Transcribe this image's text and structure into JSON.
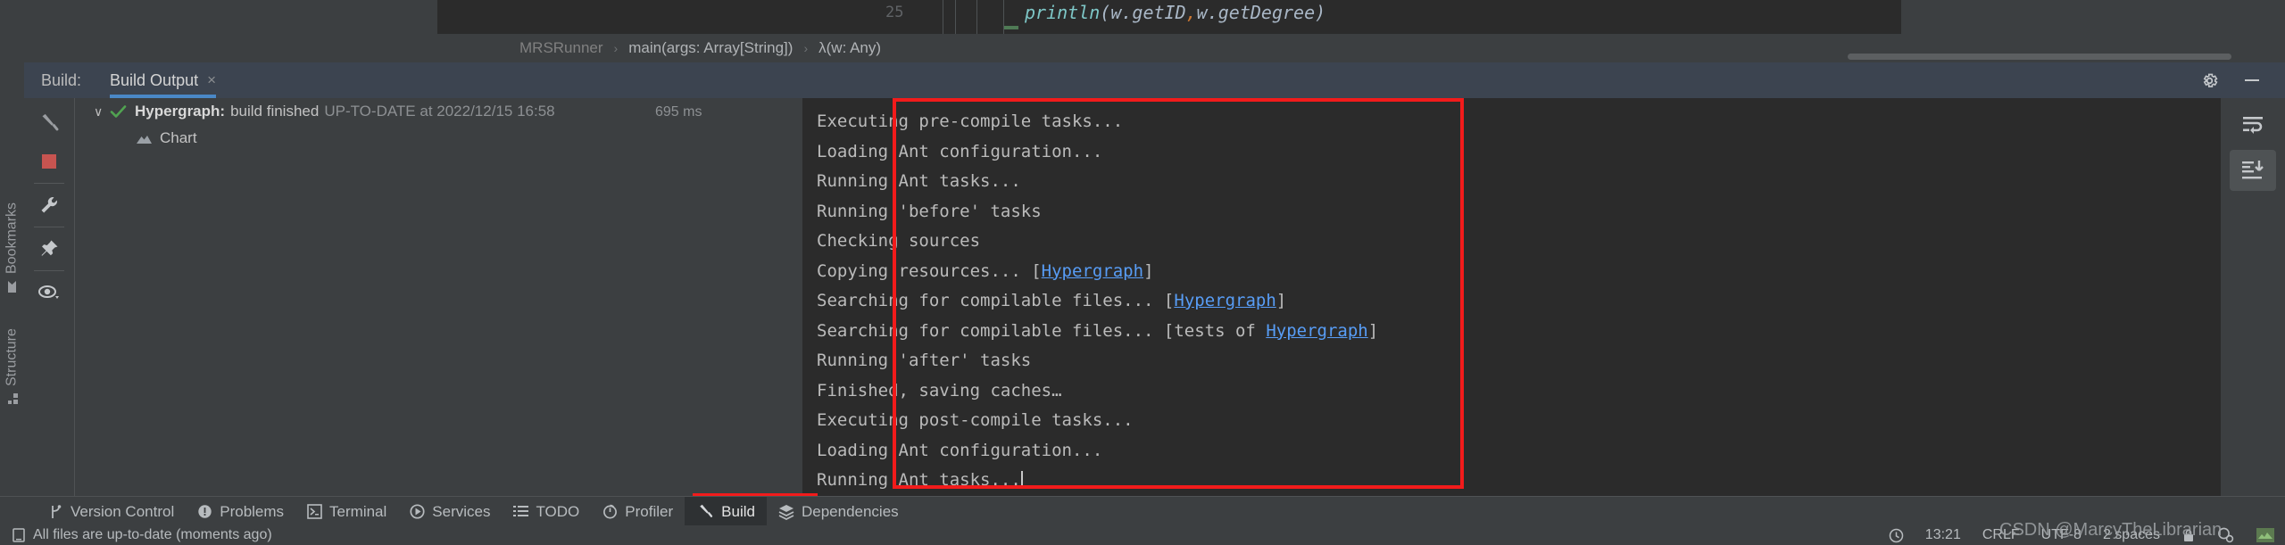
{
  "editor": {
    "line_number": "25",
    "code": {
      "fn": "println",
      "open": "(w.getID",
      "comma": ",",
      "rest": "w.getDegree)"
    },
    "breadcrumb": [
      "MRSRunner",
      "main(args: Array[String])",
      "λ(w: Any)"
    ],
    "breadcrumb_separator": "›"
  },
  "left_strip": {
    "bookmarks_label": "Bookmarks",
    "structure_label": "Structure",
    "bookmarks_icon": "bookmark-icon",
    "structure_icon": "structure-icon"
  },
  "build_panel": {
    "title": "Build:",
    "tab_label": "Build Output",
    "tab_close": "×",
    "header_icons": [
      "gear-icon",
      "minimize-icon"
    ],
    "tools": [
      "hammer-icon",
      "stop-icon",
      "wrench-icon",
      "pin-icon",
      "eye-icon"
    ],
    "console_tools": [
      "soft-wrap-icon",
      "scroll-to-end-icon"
    ],
    "tree": {
      "root": {
        "chevron": "∨",
        "status_icon": "check-icon",
        "name": "Hypergraph:",
        "action": "build finished",
        "detail": "UP-TO-DATE at 2022/12/15 16:58",
        "duration": "695 ms"
      },
      "children": [
        {
          "icon": "chart-icon",
          "label": "Chart"
        }
      ]
    },
    "console_lines": [
      {
        "text": "Executing pre-compile tasks..."
      },
      {
        "text": "Loading Ant configuration..."
      },
      {
        "text": "Running Ant tasks..."
      },
      {
        "text": "Running 'before' tasks"
      },
      {
        "text": "Checking sources"
      },
      {
        "pre": "Copying resources... [",
        "link": "Hypergraph",
        "post": "]"
      },
      {
        "pre": "Searching for compilable files... [",
        "link": "Hypergraph",
        "post": "]"
      },
      {
        "pre": "Searching for compilable files... [tests of ",
        "link": "Hypergraph",
        "post": "]"
      },
      {
        "text": "Running 'after' tasks"
      },
      {
        "text": "Finished, saving caches…"
      },
      {
        "text": "Executing post-compile tasks..."
      },
      {
        "text": "Loading Ant configuration..."
      },
      {
        "text": "Running Ant tasks...",
        "caret": true
      }
    ]
  },
  "bottom_bar": {
    "items": [
      {
        "label": "Version Control",
        "icon": "branch-icon",
        "active": false
      },
      {
        "label": "Problems",
        "icon": "problems-icon",
        "active": false
      },
      {
        "label": "Terminal",
        "icon": "terminal-icon",
        "active": false
      },
      {
        "label": "Services",
        "icon": "services-icon",
        "active": false
      },
      {
        "label": "TODO",
        "icon": "todo-icon",
        "active": false
      },
      {
        "label": "Profiler",
        "icon": "profiler-icon",
        "active": false
      },
      {
        "label": "Build",
        "icon": "hammer-icon",
        "active": true
      },
      {
        "label": "Dependencies",
        "icon": "dependencies-icon",
        "active": false
      }
    ]
  },
  "status_bar": {
    "message": "All files are up-to-date (moments ago)",
    "message_icon": "file-icon",
    "time": "13:21",
    "line_separator": "CRLF",
    "encoding": "UTF-8",
    "indent": "2 spaces",
    "clock_icon": "clock-icon",
    "right_icons": [
      "lock-icon",
      "inspection-icon",
      "memory-icon"
    ]
  },
  "watermark": {
    "text": "CSDN @MarcyTheLibrarian"
  },
  "colors": {
    "accent_blue": "#4a88c7",
    "link_blue": "#589df6",
    "annotation_red": "#f21b1b",
    "success_green": "#51a351",
    "stop_red": "#c75450",
    "console_bg": "#2b2b2b",
    "panel_bg": "#3c3f41",
    "header_bg": "#3c4450"
  }
}
